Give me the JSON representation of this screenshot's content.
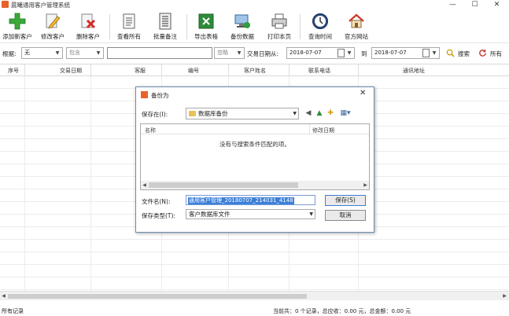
{
  "app": {
    "title": "晨曦通用客户管理系统"
  },
  "window": {
    "minimize": "—",
    "maximize": "☐",
    "close": "✕"
  },
  "toolbar": {
    "items": [
      {
        "label": "添加新客户",
        "icon": "add-icon"
      },
      {
        "label": "修改客户",
        "icon": "edit-icon"
      },
      {
        "label": "删除客户",
        "icon": "delete-icon"
      },
      {
        "label": "查看所有",
        "icon": "view-all-icon"
      },
      {
        "label": "批量备注",
        "icon": "note-icon"
      },
      {
        "label": "导出表格",
        "icon": "excel-icon"
      },
      {
        "label": "备份数据",
        "icon": "backup-icon"
      },
      {
        "label": "打印本页",
        "icon": "print-icon"
      },
      {
        "label": "查询时间",
        "icon": "clock-icon"
      },
      {
        "label": "官方网站",
        "icon": "home-icon"
      }
    ]
  },
  "filter": {
    "by_label": "根据:",
    "field_value": "无",
    "match_value": "包含",
    "search_text": "",
    "mode_value": "忽略",
    "date_from_label": "交易日期从:",
    "date_from": "2018-07-07",
    "date_to_label": "到",
    "date_to": "2018-07-07",
    "search_label": "搜索",
    "all_label": "所有"
  },
  "grid": {
    "columns": [
      "序号",
      "交易日期",
      "客服",
      "编号",
      "客户姓名",
      "联系电话",
      "通讯地址"
    ]
  },
  "status": {
    "left": "所有记录",
    "right": "当前共：0 个记录，总应收：0.00 元，总金额：0.00 元"
  },
  "dialog": {
    "title": "备份为",
    "save_in_label": "保存在(I):",
    "folder": "数据库备份",
    "col_name": "名称",
    "col_modified": "修改日期",
    "empty_message": "没有与搜索条件匹配的项。",
    "filename_label": "文件名(N):",
    "filename_value": "通用客户管理_20180707_214031_4148",
    "filetype_label": "保存类型(T):",
    "filetype_value": "客户数据库文件",
    "save_button": "保存(S)",
    "cancel_button": "取消",
    "close": "✕"
  },
  "colors": {
    "accent": "#3b7fd9",
    "dialog_border": "#6f8cb0",
    "app_icon": "#e8622a"
  }
}
